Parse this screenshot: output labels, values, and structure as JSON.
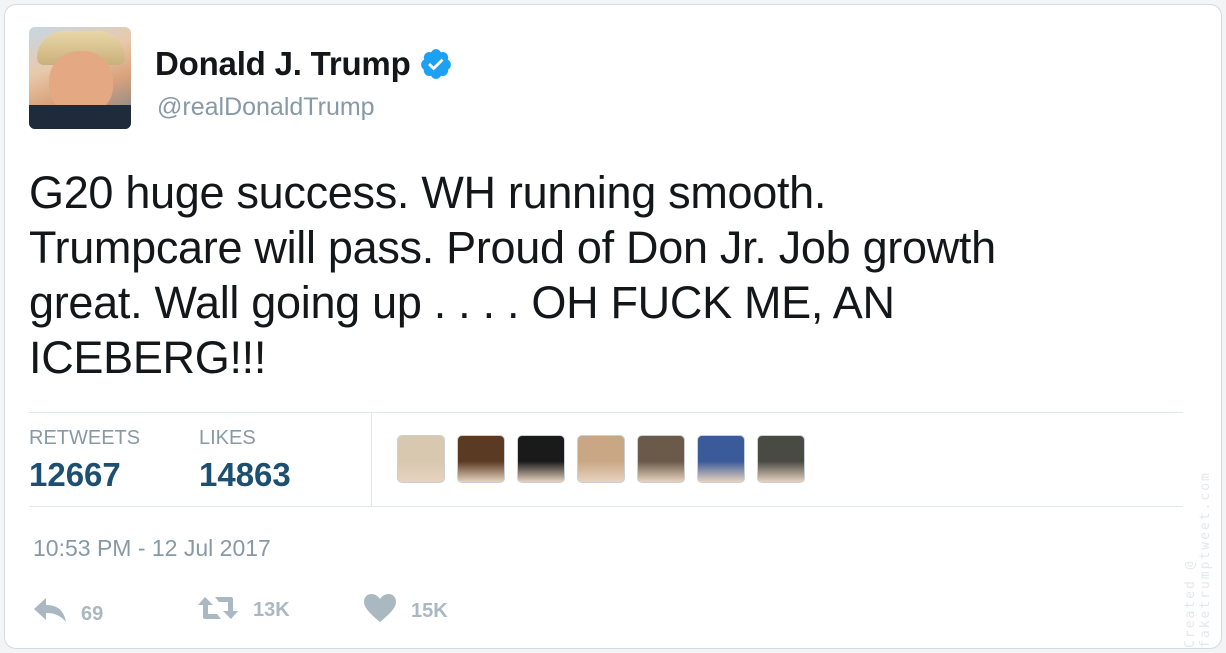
{
  "user": {
    "display_name": "Donald J. Trump",
    "handle": "@realDonaldTrump",
    "verified_icon": "verified-badge-icon",
    "avatar": "profile-photo"
  },
  "tweet": {
    "text": "G20 huge success. WH running smooth.\nTrumpcare will pass. Proud of Don Jr. Job growth\ngreat. Wall going up . . . . OH FUCK ME, AN\nICEBERG!!!",
    "timestamp": "10:53 PM - 12 Jul 2017"
  },
  "stats": {
    "retweets_label": "RETWEETS",
    "retweets_value": "12667",
    "likes_label": "LIKES",
    "likes_value": "14863"
  },
  "liker_avatars": [
    {
      "name": "liker-avatar-1",
      "color": "#d8c8b0"
    },
    {
      "name": "liker-avatar-2",
      "color": "#5a3a22"
    },
    {
      "name": "liker-avatar-3",
      "color": "#1a1a1a"
    },
    {
      "name": "liker-avatar-4",
      "color": "#c9a784"
    },
    {
      "name": "liker-avatar-5",
      "color": "#6b5a4a"
    },
    {
      "name": "liker-avatar-6",
      "color": "#3b5a9a"
    },
    {
      "name": "liker-avatar-7",
      "color": "#4a4a44"
    }
  ],
  "actions": {
    "reply_icon": "reply-icon",
    "reply_count": "69",
    "retweet_icon": "retweet-icon",
    "retweet_count": "13K",
    "like_icon": "heart-icon",
    "like_count": "15K"
  },
  "watermark": "Created @ faketrumptweet.com",
  "colors": {
    "text": "#14171a",
    "muted": "#8899a6",
    "stat_value": "#1c4f70",
    "verified": "#1da1f2",
    "action_gray": "#aab8c2"
  }
}
